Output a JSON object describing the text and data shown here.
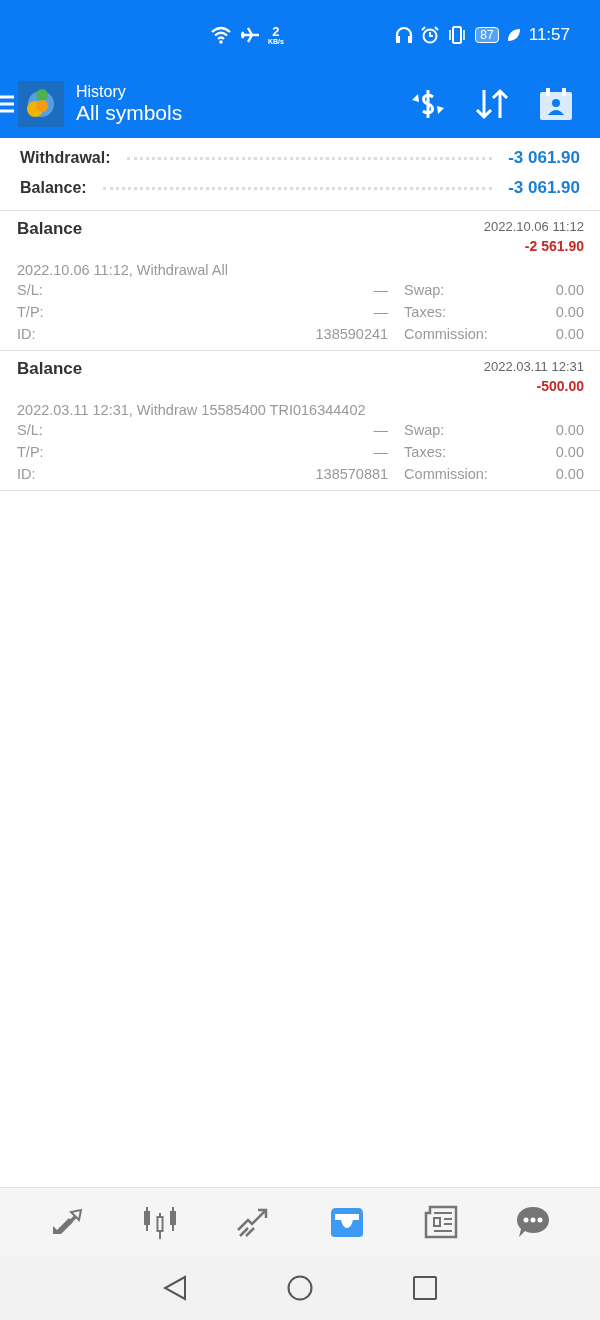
{
  "status_bar": {
    "speed_value": "2",
    "speed_unit": "KB/s",
    "battery": "87",
    "time": "11:57"
  },
  "app_bar": {
    "subtitle": "History",
    "title": "All symbols"
  },
  "summary": [
    {
      "label": "Withdrawal:",
      "value": "-3 061.90"
    },
    {
      "label": "Balance:",
      "value": "-3 061.90"
    }
  ],
  "deals": [
    {
      "type": "Balance",
      "time": "2022.10.06 11:12",
      "amount": "-2 561.90",
      "comment": "2022.10.06 11:12, Withdrawal All",
      "sl_label": "S/L:",
      "sl": "—",
      "tp_label": "T/P:",
      "tp": "—",
      "id_label": "ID:",
      "id": "138590241",
      "swap_label": "Swap:",
      "swap": "0.00",
      "taxes_label": "Taxes:",
      "taxes": "0.00",
      "commission_label": "Commission:",
      "commission": "0.00"
    },
    {
      "type": "Balance",
      "time": "2022.03.11 12:31",
      "amount": "-500.00",
      "comment": "2022.03.11 12:31, Withdraw 15585400 TRI016344402",
      "sl_label": "S/L:",
      "sl": "—",
      "tp_label": "T/P:",
      "tp": "—",
      "id_label": "ID:",
      "id": "138570881",
      "swap_label": "Swap:",
      "swap": "0.00",
      "taxes_label": "Taxes:",
      "taxes": "0.00",
      "commission_label": "Commission:",
      "commission": "0.00"
    }
  ],
  "bottom_nav": [
    {
      "kind": "quotes",
      "selected": false
    },
    {
      "kind": "chart",
      "selected": false
    },
    {
      "kind": "trade",
      "selected": false
    },
    {
      "kind": "history",
      "selected": true
    },
    {
      "kind": "news",
      "selected": false
    },
    {
      "kind": "chat",
      "selected": false
    }
  ]
}
